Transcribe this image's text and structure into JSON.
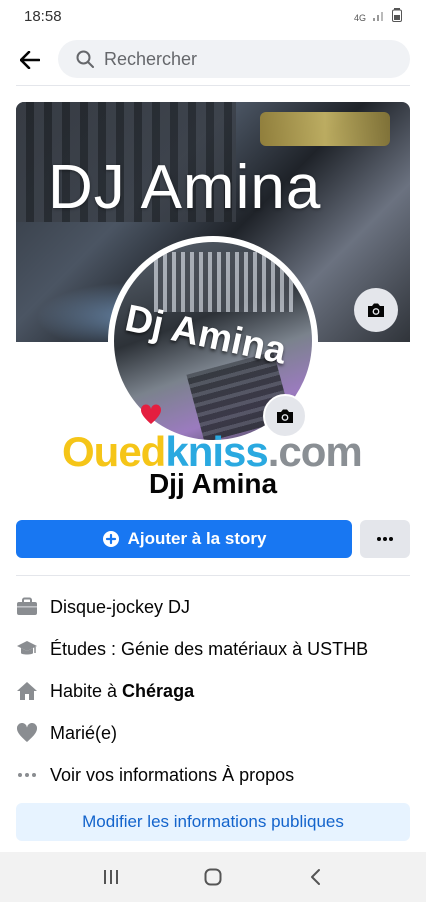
{
  "status_bar": {
    "time": "18:58",
    "network": "4G"
  },
  "search": {
    "placeholder": "Rechercher"
  },
  "cover": {
    "title": "DJ Amina"
  },
  "avatar": {
    "overlay_text": "Dj Amina"
  },
  "watermark": {
    "part1": "Oued",
    "part2": "kniss",
    "part3": ".com"
  },
  "profile": {
    "name": "Djj Amina"
  },
  "actions": {
    "add_story_label": "Ajouter à la story"
  },
  "info": {
    "job": "Disque-jockey DJ",
    "education": "Études : Génie des matériaux à USTHB",
    "lives_prefix": "Habite à ",
    "lives_city": "Chéraga",
    "relationship": "Marié(e)",
    "about_link": "Voir vos informations À propos"
  },
  "edit_button": {
    "label": "Modifier les informations publiques"
  },
  "colors": {
    "primary": "#1877f2",
    "edit_bg": "#e7f3ff",
    "edit_text": "#1464cc",
    "gray_btn": "#e4e6eb"
  },
  "icons": [
    "back-arrow-icon",
    "search-icon",
    "camera-icon",
    "plus-circle-icon",
    "more-icon",
    "briefcase-icon",
    "graduation-cap-icon",
    "home-icon",
    "heart-icon",
    "ellipsis-icon",
    "recent-apps-icon",
    "home-nav-icon",
    "back-nav-icon"
  ]
}
